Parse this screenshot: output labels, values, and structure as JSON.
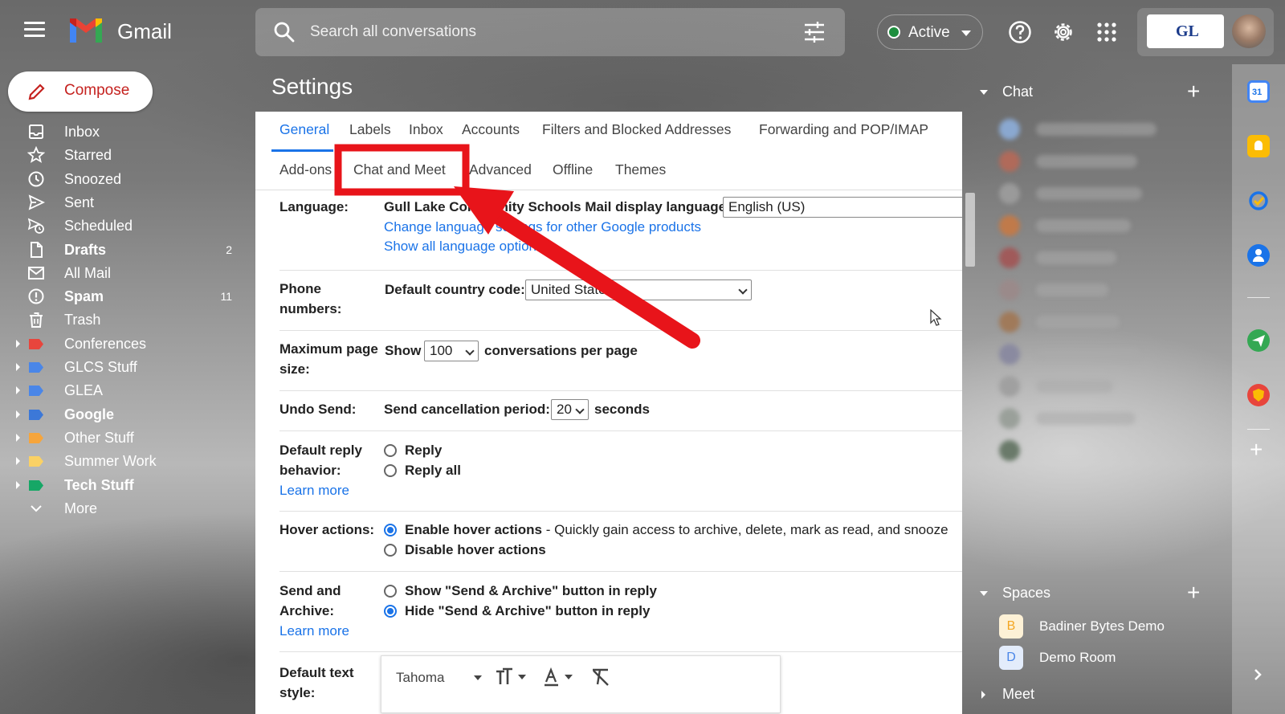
{
  "header": {
    "brand": "Gmail",
    "search_placeholder": "Search all conversations",
    "status_label": "Active",
    "org_logo": "GL"
  },
  "nav": {
    "compose_label": "Compose",
    "items": [
      {
        "label": "Inbox",
        "icon": "inbox-icon",
        "bold": false,
        "count": ""
      },
      {
        "label": "Starred",
        "icon": "star-icon",
        "bold": false,
        "count": ""
      },
      {
        "label": "Snoozed",
        "icon": "clock-icon",
        "bold": false,
        "count": ""
      },
      {
        "label": "Sent",
        "icon": "send-icon",
        "bold": false,
        "count": ""
      },
      {
        "label": "Scheduled",
        "icon": "scheduled-icon",
        "bold": false,
        "count": ""
      },
      {
        "label": "Drafts",
        "icon": "file-icon",
        "bold": true,
        "count": "2"
      },
      {
        "label": "All Mail",
        "icon": "mail-icon",
        "bold": false,
        "count": ""
      },
      {
        "label": "Spam",
        "icon": "report-icon",
        "bold": true,
        "count": "11"
      },
      {
        "label": "Trash",
        "icon": "trash-icon",
        "bold": false,
        "count": ""
      }
    ],
    "labels": [
      {
        "label": "Conferences",
        "color": "#e8453c",
        "bold": false
      },
      {
        "label": "GLCS Stuff",
        "color": "#4a86e8",
        "bold": false
      },
      {
        "label": "GLEA",
        "color": "#4a86e8",
        "bold": false
      },
      {
        "label": "Google",
        "color": "#3c78d8",
        "bold": true
      },
      {
        "label": "Other Stuff",
        "color": "#f6a53c",
        "bold": false
      },
      {
        "label": "Summer Work",
        "color": "#fad165",
        "bold": false
      },
      {
        "label": "Tech Stuff",
        "color": "#16a766",
        "bold": true
      }
    ],
    "more_label": "More"
  },
  "settings": {
    "title": "Settings",
    "tabs_row1": [
      "General",
      "Labels",
      "Inbox",
      "Accounts",
      "Filters and Blocked Addresses",
      "Forwarding and POP/IMAP"
    ],
    "tabs_row2": [
      "Add-ons",
      "Chat and Meet",
      "Advanced",
      "Offline",
      "Themes"
    ],
    "active_tab": "General",
    "language": {
      "label": "Language:",
      "display_text": "Gull Lake Community Schools Mail display language:",
      "value": "English (US)",
      "link1": "Change language settings for other Google products",
      "link2": "Show all language options"
    },
    "phone": {
      "label_line1": "Phone",
      "label_line2": "numbers:",
      "text": "Default country code:",
      "value": "United States"
    },
    "page_size": {
      "label_line1": "Maximum page",
      "label_line2": "size:",
      "prefix": "Show",
      "value": "100",
      "suffix": "conversations per page"
    },
    "undo_send": {
      "label": "Undo Send:",
      "text": "Send cancellation period:",
      "value": "20",
      "suffix": "seconds"
    },
    "reply": {
      "label_line1": "Default reply",
      "label_line2": "behavior:",
      "learn_more": "Learn more",
      "opt1": "Reply",
      "opt2": "Reply all"
    },
    "hover": {
      "label": "Hover actions:",
      "opt1_bold": "Enable hover actions",
      "opt1_desc": " - Quickly gain access to archive, delete, mark as read, and snooze",
      "opt2": "Disable hover actions"
    },
    "send_archive": {
      "label_line1": "Send and",
      "label_line2": "Archive:",
      "learn_more": "Learn more",
      "opt1": "Show \"Send & Archive\" button in reply",
      "opt2": "Hide \"Send & Archive\" button in reply"
    },
    "text_style": {
      "label_line1": "Default text",
      "label_line2": "style:",
      "font": "Tahoma"
    }
  },
  "chat": {
    "title": "Chat",
    "spaces_title": "Spaces",
    "spaces": [
      {
        "badge": "B",
        "name": "Badiner Bytes Demo"
      },
      {
        "badge": "D",
        "name": "Demo Room"
      }
    ],
    "meet_title": "Meet"
  },
  "colors": {
    "accent": "#1a73e8",
    "annotation_red": "#e8141a",
    "compose_red": "#c5221f",
    "active_green": "#1e8e3e"
  }
}
